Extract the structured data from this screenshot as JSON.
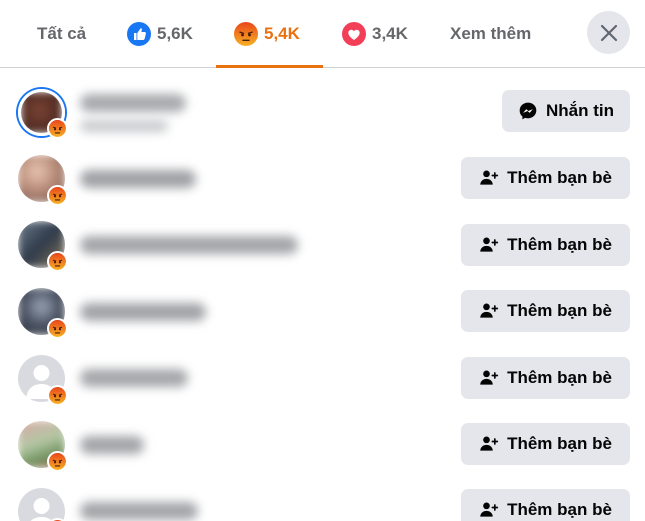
{
  "tabs": [
    {
      "label": "Tất cả",
      "icon": "none",
      "active": false
    },
    {
      "label": "5,6K",
      "icon": "like-icon",
      "active": false
    },
    {
      "label": "5,4K",
      "icon": "angry-icon",
      "active": true
    },
    {
      "label": "3,4K",
      "icon": "love-icon",
      "active": false
    },
    {
      "label": "Xem thêm",
      "icon": "none",
      "active": false
    }
  ],
  "close_icon": "close-icon",
  "colors": {
    "active_tab": "#e9710f",
    "button_bg": "#e4e6eb",
    "like_blue": "#1877f2",
    "love_red": "#f33e58",
    "angry_orange": "#f2841c"
  },
  "people": [
    {
      "reaction": "angry-icon",
      "action_label": "Nhắn tin",
      "action_icon": "messenger-icon"
    },
    {
      "reaction": "angry-icon",
      "action_label": "Thêm bạn bè",
      "action_icon": "add-friend-icon"
    },
    {
      "reaction": "angry-icon",
      "action_label": "Thêm bạn bè",
      "action_icon": "add-friend-icon"
    },
    {
      "reaction": "angry-icon",
      "action_label": "Thêm bạn bè",
      "action_icon": "add-friend-icon"
    },
    {
      "reaction": "angry-icon",
      "action_label": "Thêm bạn bè",
      "action_icon": "add-friend-icon"
    },
    {
      "reaction": "angry-icon",
      "action_label": "Thêm bạn bè",
      "action_icon": "add-friend-icon"
    },
    {
      "reaction": "angry-icon",
      "action_label": "Thêm bạn bè",
      "action_icon": "add-friend-icon"
    }
  ]
}
